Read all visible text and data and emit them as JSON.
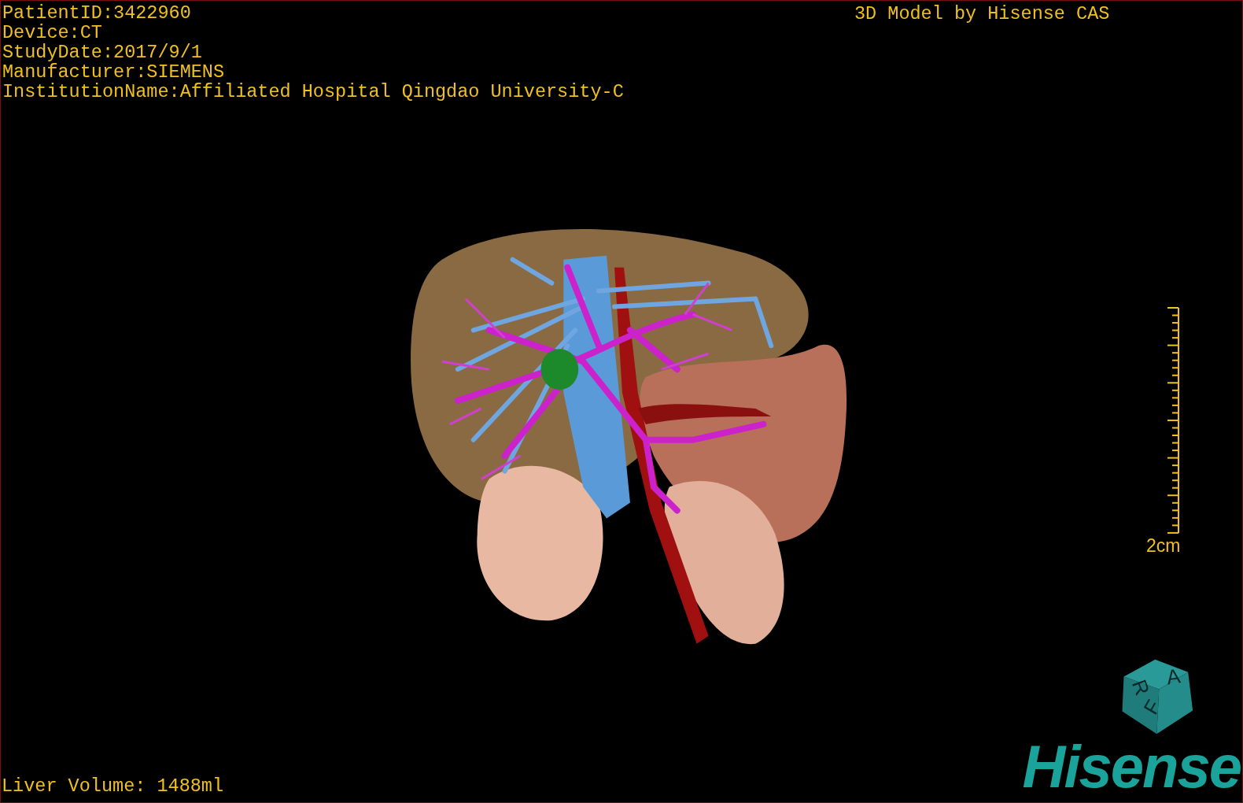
{
  "viewport": {
    "patient_info": [
      "PatientID:3422960",
      "Device:CT",
      "StudyDate:2017/9/1",
      "Manufacturer:SIEMENS",
      "InstitutionName:Affiliated Hospital Qingdao University-C"
    ],
    "model_credit": "3D Model by Hisense CAS",
    "scale_bar": {
      "label": "2cm"
    },
    "orientation_cube": {
      "faces": [
        "A",
        "R",
        "F"
      ]
    },
    "liver_volume": "Liver Volume: 1488ml",
    "logo": "Hisense"
  }
}
